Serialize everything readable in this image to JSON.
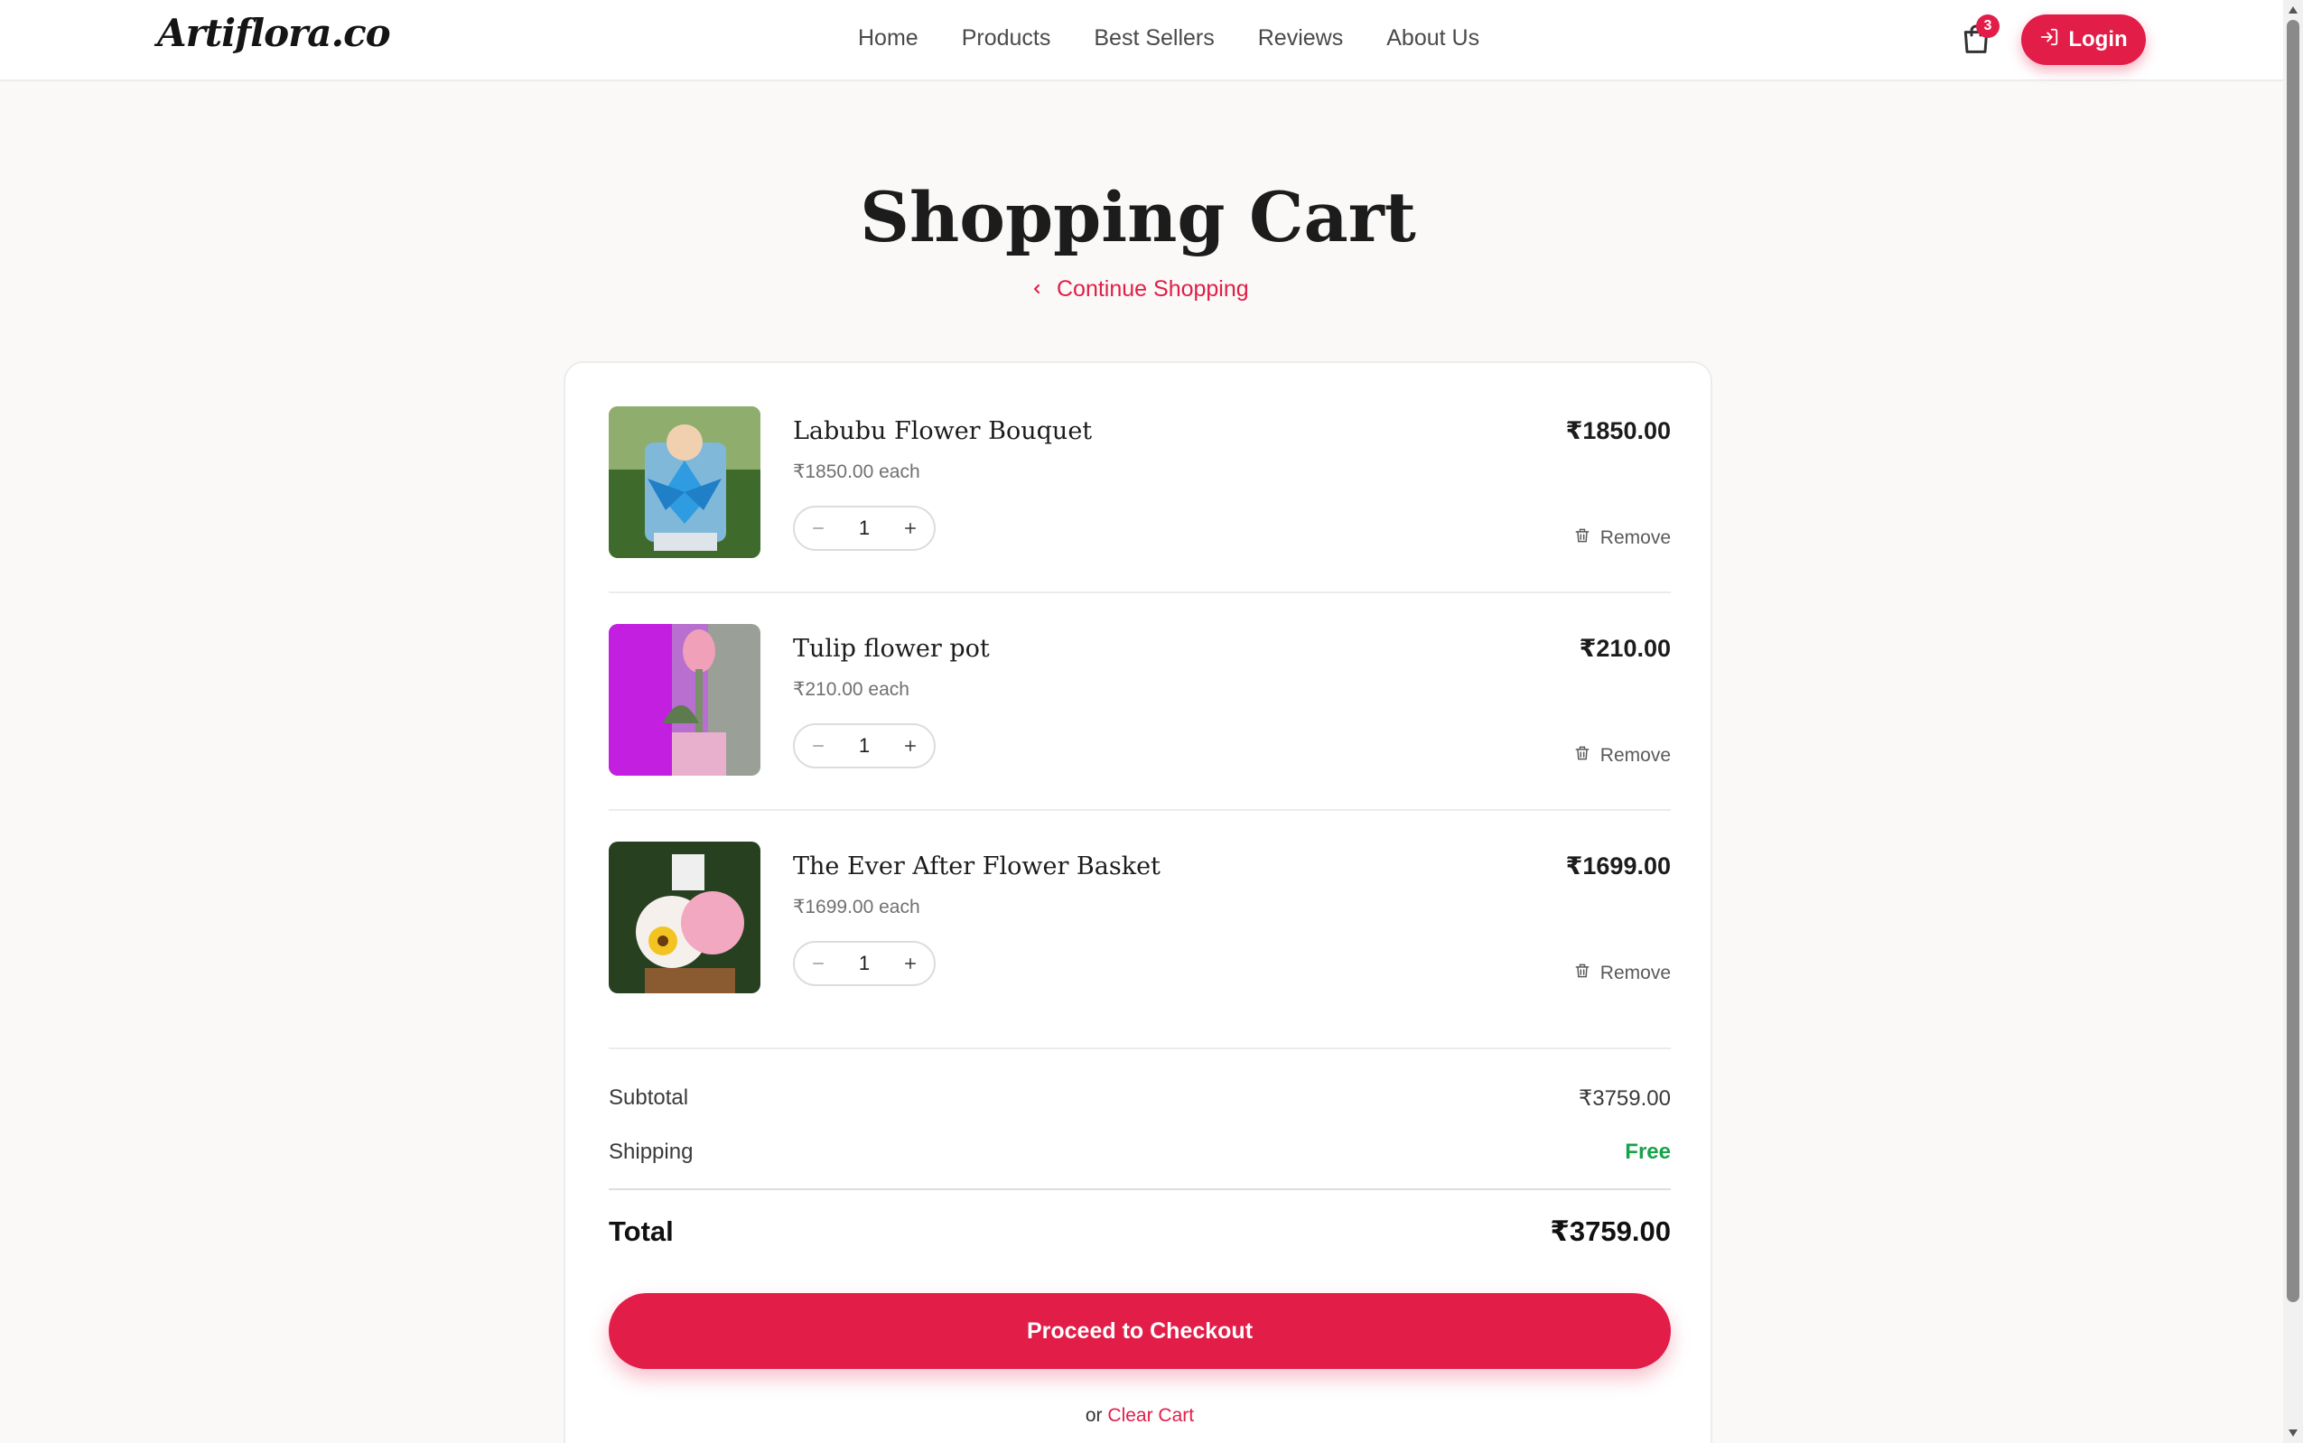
{
  "brand": {
    "logo": "Artiflora.co"
  },
  "nav": {
    "items": [
      {
        "label": "Home"
      },
      {
        "label": "Products"
      },
      {
        "label": "Best Sellers"
      },
      {
        "label": "Reviews"
      },
      {
        "label": "About Us"
      }
    ]
  },
  "header": {
    "cart_count": "3",
    "login_label": "Login"
  },
  "page": {
    "title": "Shopping Cart",
    "continue_label": "Continue Shopping"
  },
  "cart": {
    "items": [
      {
        "name": "Labubu Flower Bouquet",
        "unit": "₹1850.00 each",
        "qty": "1",
        "price": "₹1850.00",
        "remove": "Remove",
        "thumb_colors": [
          "#3e6b2b",
          "#7fb8d9",
          "#2f9be0"
        ]
      },
      {
        "name": "Tulip flower pot",
        "unit": "₹210.00 each",
        "qty": "1",
        "price": "₹210.00",
        "remove": "Remove",
        "thumb_colors": [
          "#c21fe0",
          "#9aa098",
          "#e8b0cc"
        ]
      },
      {
        "name": "The Ever After Flower Basket",
        "unit": "₹1699.00 each",
        "qty": "1",
        "price": "₹1699.00",
        "remove": "Remove",
        "thumb_colors": [
          "#27401f",
          "#f3c421",
          "#f2a8c0"
        ]
      }
    ]
  },
  "summary": {
    "subtotal_label": "Subtotal",
    "subtotal_value": "₹3759.00",
    "shipping_label": "Shipping",
    "shipping_value": "Free",
    "total_label": "Total",
    "total_value": "₹3759.00"
  },
  "actions": {
    "checkout_label": "Proceed to Checkout",
    "or_text": "or",
    "clear_label": "Clear Cart"
  },
  "colors": {
    "accent": "#e11d48",
    "free": "#16a34a"
  }
}
